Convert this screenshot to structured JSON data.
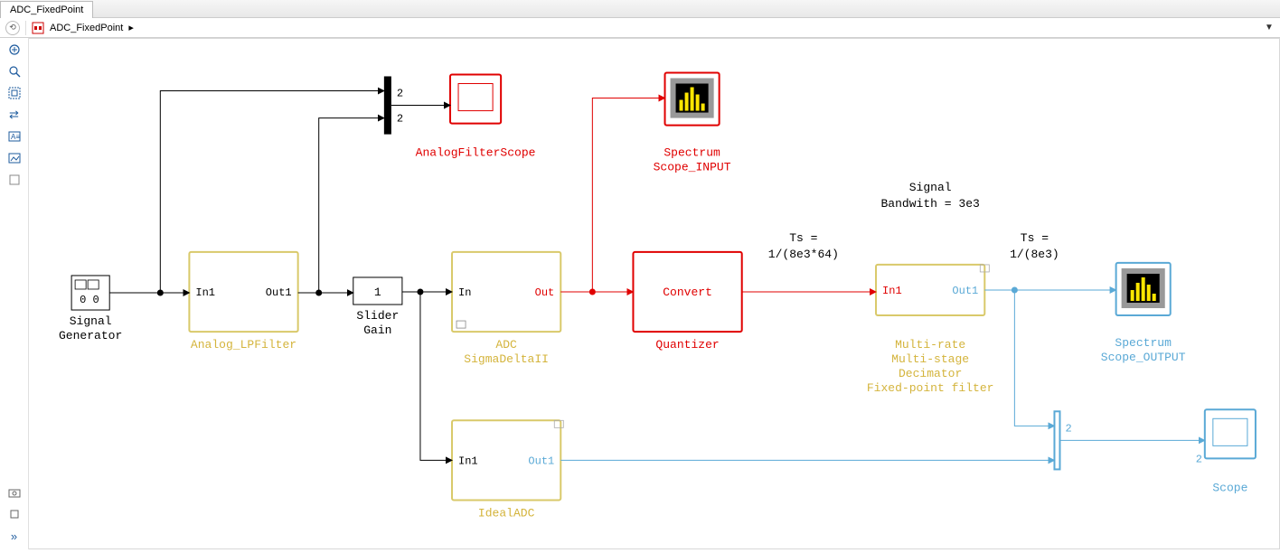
{
  "tab": {
    "name": "ADC_FixedPoint"
  },
  "breadcrumb": {
    "modelName": "ADC_FixedPoint",
    "arrow": "▸"
  },
  "annotations": {
    "signalBandwidth1": "Signal",
    "signalBandwidth2": "Bandwith = 3e3",
    "ts1a": "Ts =",
    "ts1b": "1/(8e3*64)",
    "ts2a": "Ts =",
    "ts2b": "1/(8e3)"
  },
  "blocks": {
    "signalGenerator": {
      "name": "Signal",
      "name2": "Generator",
      "faceText": "0 0"
    },
    "analogLPFilter": {
      "name": "Analog_LPFilter",
      "in": "In1",
      "out": "Out1"
    },
    "sliderGain": {
      "name": "Slider",
      "name2": "Gain",
      "value": "1"
    },
    "mux": {
      "p1": "2",
      "p2": "2"
    },
    "analogFilterScope": {
      "name": "AnalogFilterScope"
    },
    "adc": {
      "name": "ADC",
      "name2": "SigmaDeltaII",
      "in": "In",
      "out": "Out"
    },
    "spectrumInput": {
      "line1": "Spectrum",
      "line2": "Scope_INPUT"
    },
    "quantizer": {
      "name": "Quantizer",
      "face": "Convert"
    },
    "decimator": {
      "in": "In1",
      "out": "Out1",
      "l1": "Multi-rate",
      "l2": "Multi-stage",
      "l3": "Decimator",
      "l4": "Fixed-point filter"
    },
    "spectrumOutput": {
      "line1": "Spectrum",
      "line2": "Scope_OUTPUT"
    },
    "idealADC": {
      "name": "IdealADC",
      "in": "In1",
      "out": "Out1"
    },
    "mux2": {
      "p1": "2",
      "p2": "2"
    },
    "scope": {
      "name": "Scope"
    }
  }
}
